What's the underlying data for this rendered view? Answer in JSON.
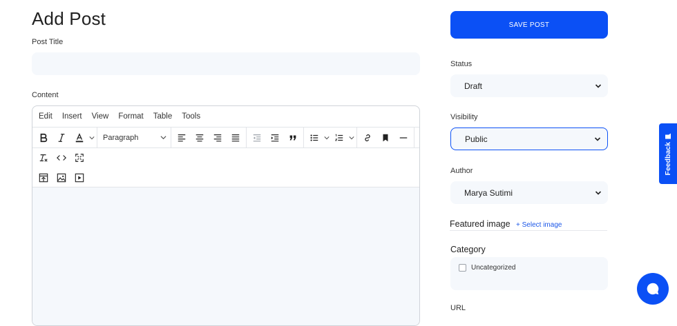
{
  "page": {
    "title": "Add Post"
  },
  "form": {
    "post_title_label": "Post Title",
    "post_title_value": "",
    "content_label": "Content"
  },
  "editor": {
    "menus": [
      "Edit",
      "Insert",
      "View",
      "Format",
      "Table",
      "Tools"
    ],
    "block_format": "Paragraph",
    "toolbar_icons": [
      "bold-icon",
      "italic-icon",
      "text-color-icon",
      "align-left-icon",
      "align-center-icon",
      "align-right-icon",
      "align-justify-icon",
      "outdent-icon",
      "indent-icon",
      "blockquote-icon",
      "bullet-list-icon",
      "numbered-list-icon",
      "link-icon",
      "bookmark-icon",
      "horizontal-rule-icon",
      "clear-format-icon",
      "code-icon",
      "fullscreen-icon",
      "upload-icon",
      "image-icon",
      "media-icon"
    ]
  },
  "sidebar": {
    "save_button": "SAVE POST",
    "status_label": "Status",
    "status_value": "Draft",
    "visibility_label": "Visibility",
    "visibility_value": "Public",
    "author_label": "Author",
    "author_value": "Marya Sutimi",
    "featured_image_label": "Featured image",
    "select_image_link": "+ Select image",
    "category_label": "Category",
    "categories": [
      {
        "label": "Uncategorized",
        "checked": false
      }
    ],
    "url_label": "URL"
  },
  "widgets": {
    "feedback_label": "Feedback"
  },
  "colors": {
    "accent": "#0b50f5",
    "input_bg": "#f5f8fc",
    "link": "#1a56e8"
  }
}
